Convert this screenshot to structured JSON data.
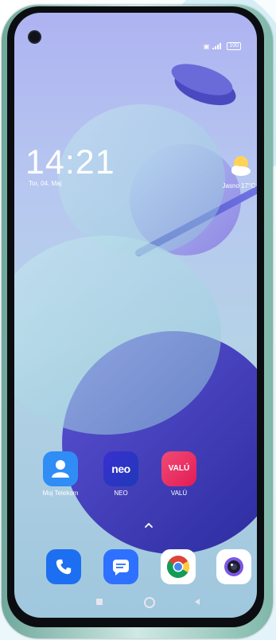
{
  "status_bar": {
    "battery": "100"
  },
  "lock": {
    "time": "14:21",
    "date": "Tor, 04. Maj"
  },
  "weather": {
    "text": "Jasno  17°C",
    "icon": "sun-cloud-icon"
  },
  "apps": [
    {
      "label": "Moj Telekom",
      "icon": "person-icon",
      "color": "#2f8df5"
    },
    {
      "label": "NEO",
      "icon_text": "neo",
      "color": "#2d36c9"
    },
    {
      "label": "VALÚ",
      "icon_text": "VALÚ",
      "color": "#ea2b64"
    }
  ],
  "dock": [
    {
      "icon": "phone-icon",
      "color": "#1c6ff0"
    },
    {
      "icon": "messages-icon",
      "color": "#2e70ff"
    },
    {
      "icon": "chrome-icon",
      "color": "#ffffff"
    },
    {
      "icon": "camera-icon",
      "color": "#ffffff"
    }
  ],
  "colors": {
    "accent": "#2f8df5"
  }
}
